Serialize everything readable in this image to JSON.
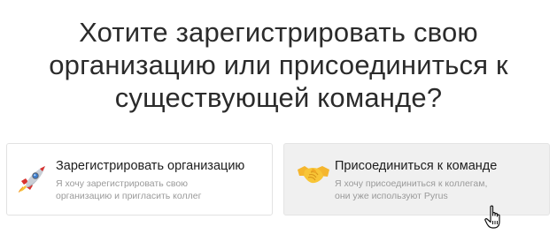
{
  "heading": {
    "lines": [
      "Хотите зарегистрировать свою",
      "организацию или присоединиться к",
      "существующей команде?"
    ]
  },
  "options": {
    "register": {
      "icon": "rocket-icon",
      "title": "Зарегистрировать организацию",
      "description_lines": [
        "Я хочу зарегистрировать свою",
        "организацию и пригласить коллег"
      ]
    },
    "join": {
      "icon": "handshake-icon",
      "title": "Присоединиться к команде",
      "description_lines": [
        "Я хочу присоединиться к коллегам,",
        "они уже используют Pyrus"
      ],
      "state": "hovered"
    }
  },
  "colors": {
    "heading_text": "#2b2b2b",
    "title_text": "#1d1d1d",
    "description_text": "#9a9a9a",
    "card_border": "#e2e2e2",
    "hover_background": "#f0f0f0"
  }
}
